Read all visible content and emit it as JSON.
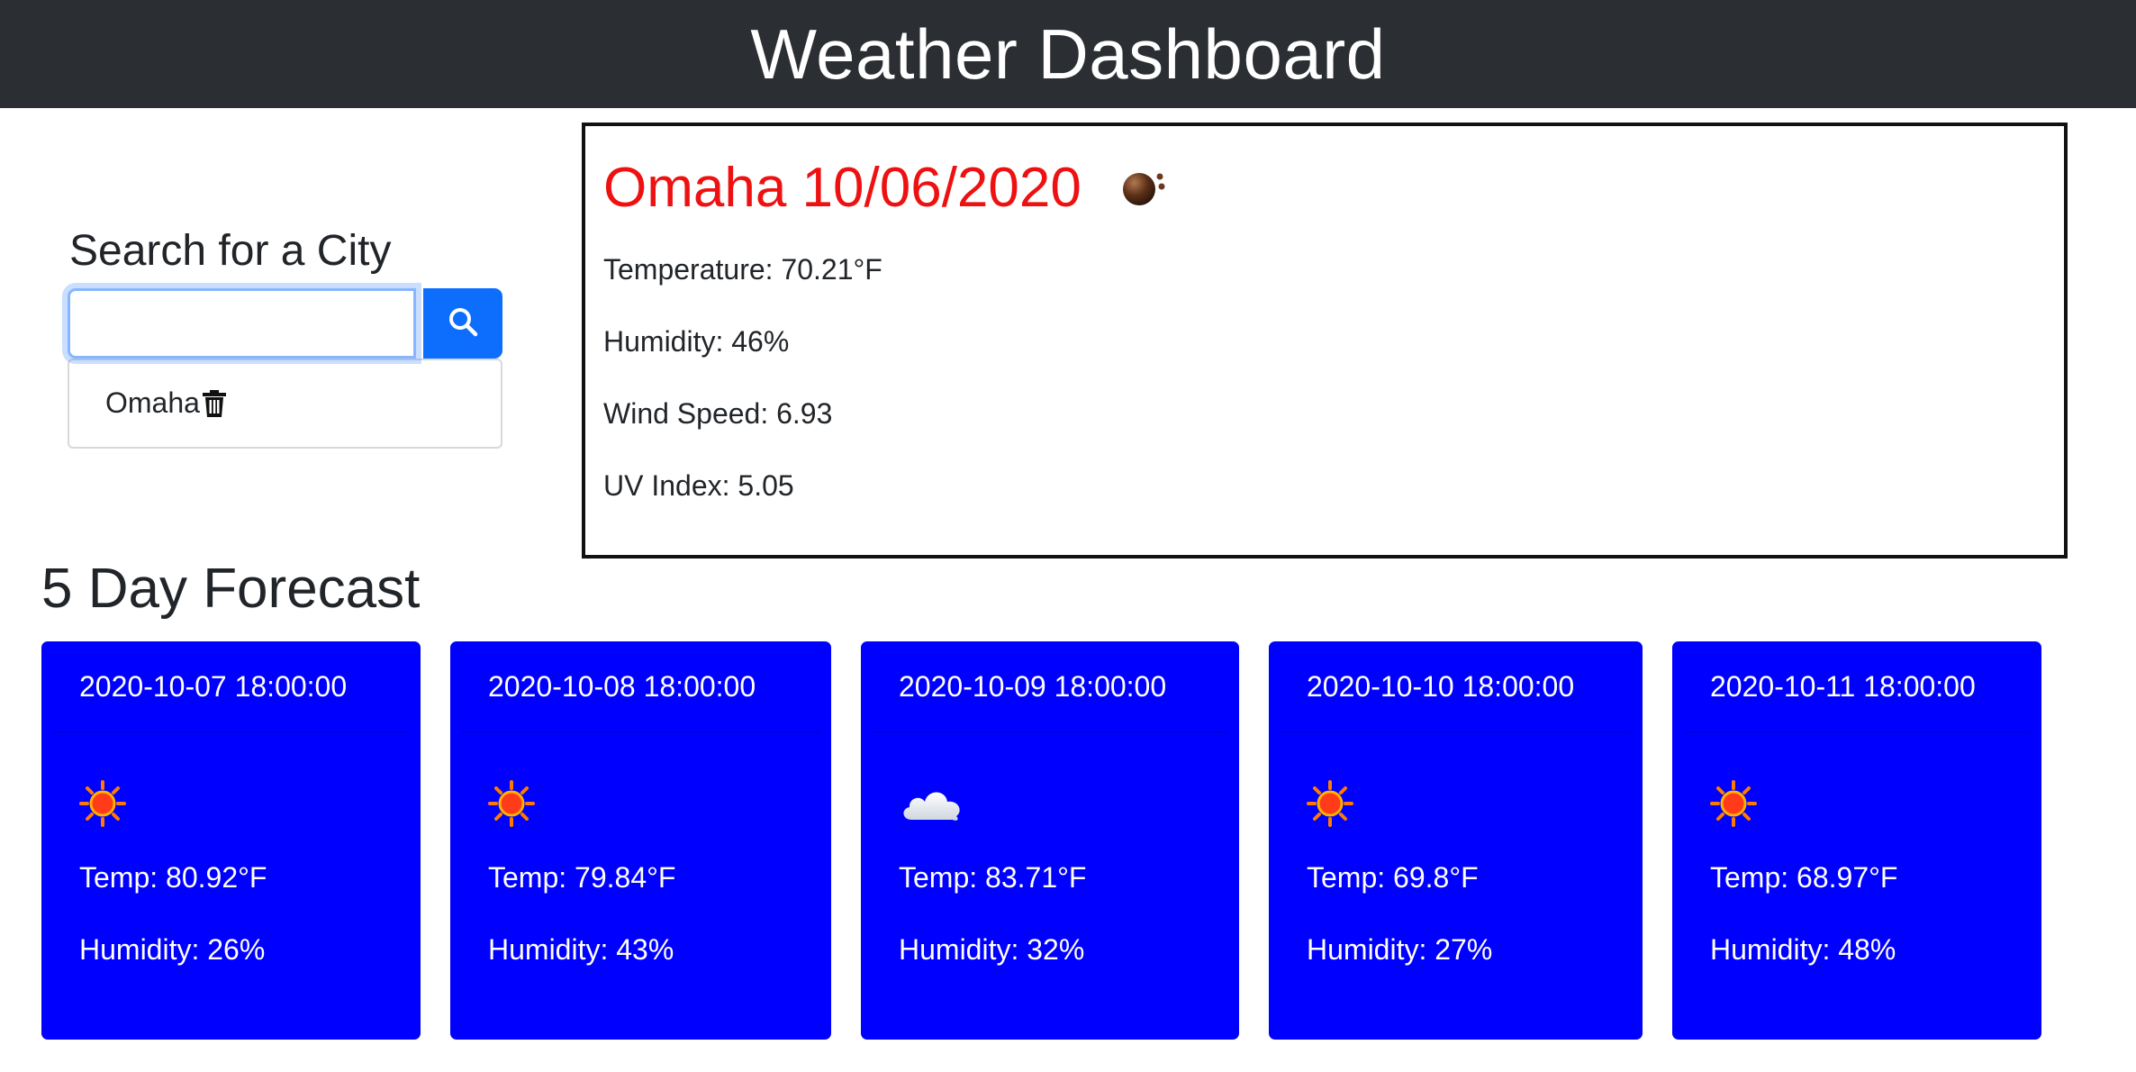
{
  "header": {
    "title": "Weather Dashboard"
  },
  "search": {
    "title": "Search for a City",
    "value": "",
    "placeholder": "",
    "button_icon": "search-icon"
  },
  "history": [
    {
      "label": "Omaha",
      "icon": "trash-icon"
    }
  ],
  "current": {
    "title": "Omaha 10/06/2020",
    "icon": "dark-clouds-icon",
    "temperature": "Temperature: 70.21°F",
    "humidity": "Humidity: 46%",
    "wind": "Wind Speed: 6.93",
    "uv": "UV Index: 5.05",
    "title_color": "#ee1111"
  },
  "forecast": {
    "title": "5 Day Forecast",
    "card_color": "#0000ff",
    "days": [
      {
        "date": "2020-10-07 18:00:00",
        "icon": "sun-icon",
        "temp": "Temp: 80.92°F",
        "humidity": "Humidity: 26%"
      },
      {
        "date": "2020-10-08 18:00:00",
        "icon": "sun-icon",
        "temp": "Temp: 79.84°F",
        "humidity": "Humidity: 43%"
      },
      {
        "date": "2020-10-09 18:00:00",
        "icon": "cloud-icon",
        "temp": "Temp: 83.71°F",
        "humidity": "Humidity: 32%"
      },
      {
        "date": "2020-10-10 18:00:00",
        "icon": "sun-icon",
        "temp": "Temp: 69.8°F",
        "humidity": "Humidity: 27%"
      },
      {
        "date": "2020-10-11 18:00:00",
        "icon": "sun-icon",
        "temp": "Temp: 68.97°F",
        "humidity": "Humidity: 48%"
      }
    ]
  }
}
